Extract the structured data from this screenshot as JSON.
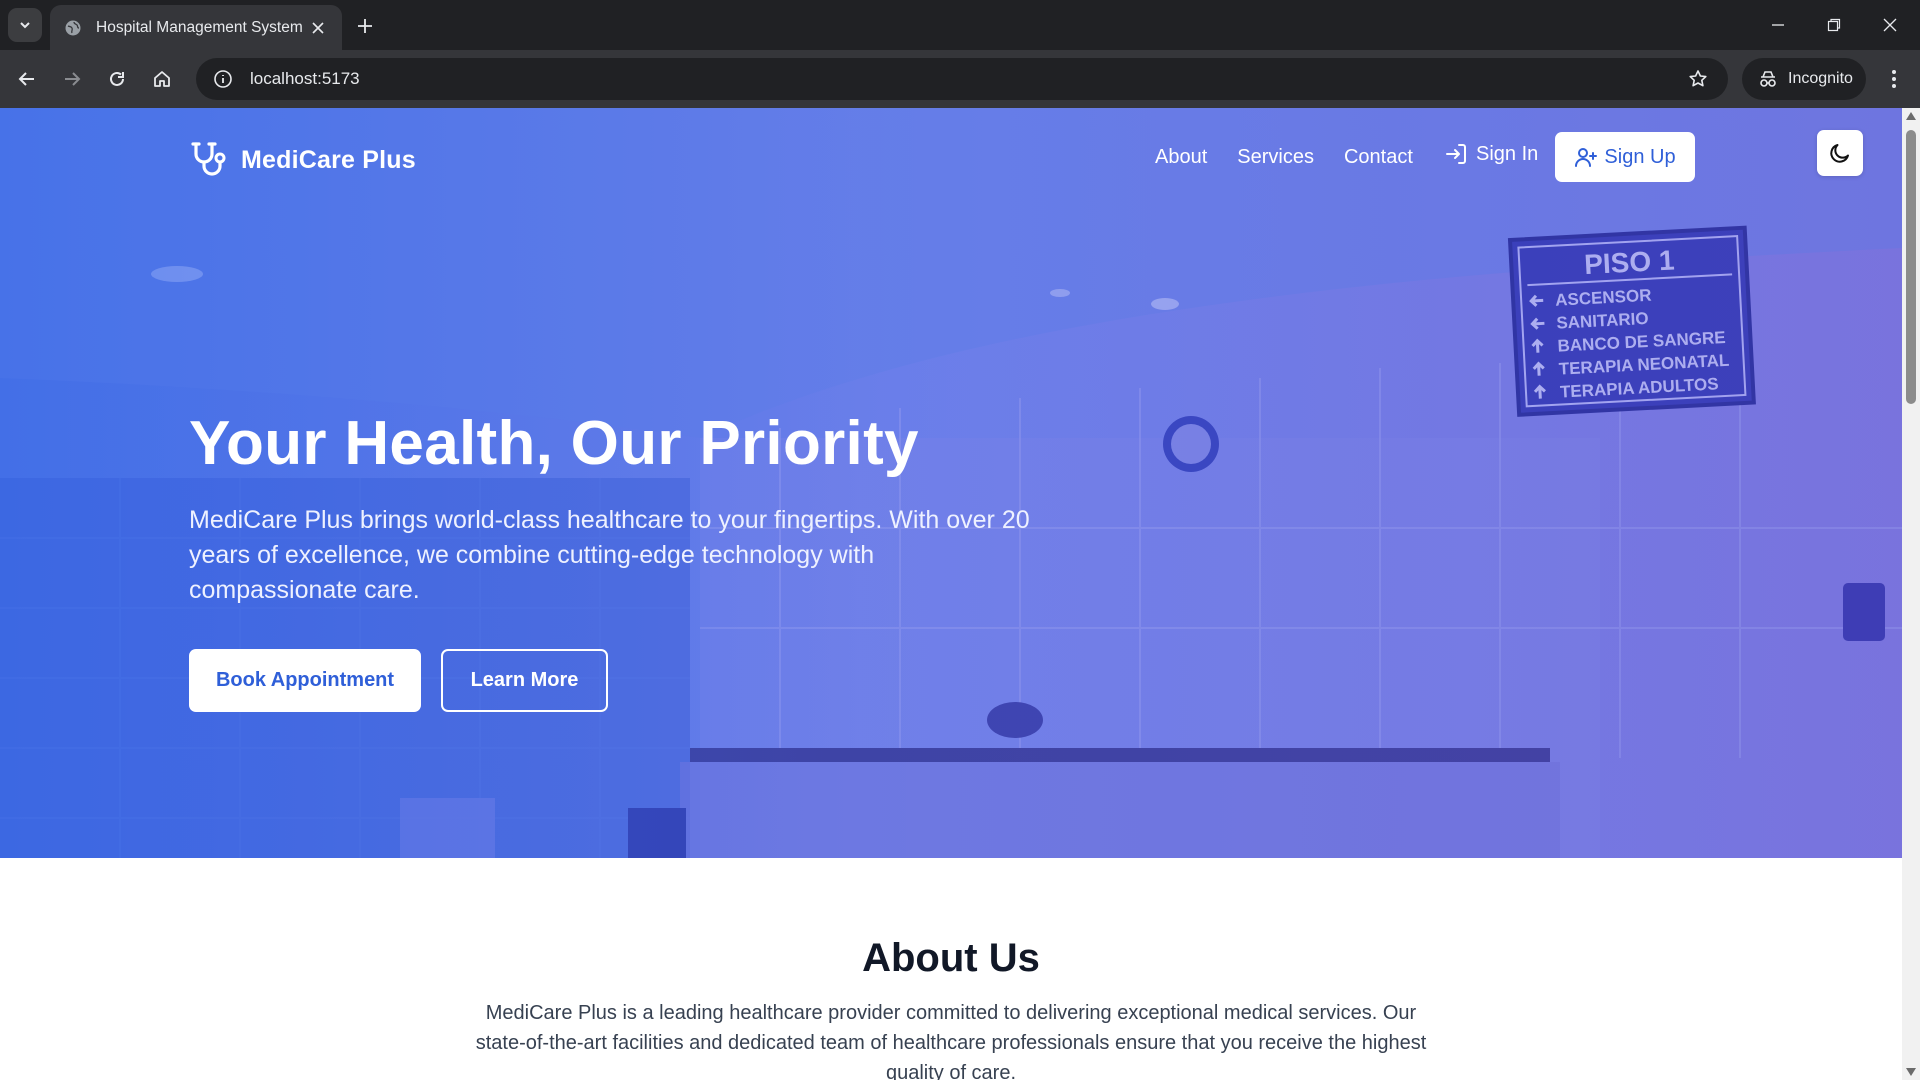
{
  "browser": {
    "tab_title": "Hospital Management System",
    "url": "localhost:5173",
    "incognito_label": "Incognito"
  },
  "site": {
    "brand": "MediCare Plus",
    "nav": {
      "about": "About",
      "services": "Services",
      "contact": "Contact",
      "sign_in": "Sign In",
      "sign_up": "Sign Up"
    }
  },
  "hero": {
    "title": "Your Health, Our Priority",
    "lead": "MediCare Plus brings world-class healthcare to your fingertips. With over 20 years of excellence, we combine cutting-edge technology with compassionate care.",
    "book_button": "Book Appointment",
    "learn_button": "Learn More",
    "sign": {
      "heading": "PISO 1",
      "lines": [
        "ASCENSOR",
        "SANITARIO",
        "BANCO DE SANGRE",
        "TERAPIA NEONATAL",
        "TERAPIA ADULTOS"
      ]
    }
  },
  "about": {
    "heading": "About Us",
    "body": "MediCare Plus is a leading healthcare provider committed to delivering exceptional medical services. Our state-of-the-art facilities and dedicated team of healthcare professionals ensure that you receive the highest quality of care."
  },
  "colors": {
    "primary": "#2f5fd8",
    "hero_gradient_start": "#2a5ae1",
    "hero_gradient_end": "#5f4ec3",
    "chrome_dark": "#202124",
    "chrome_toolbar": "#35363a"
  },
  "icons": {
    "brand": "stethoscope-icon",
    "sign_in": "log-in-icon",
    "sign_up": "user-plus-icon",
    "theme": "moon-icon"
  }
}
